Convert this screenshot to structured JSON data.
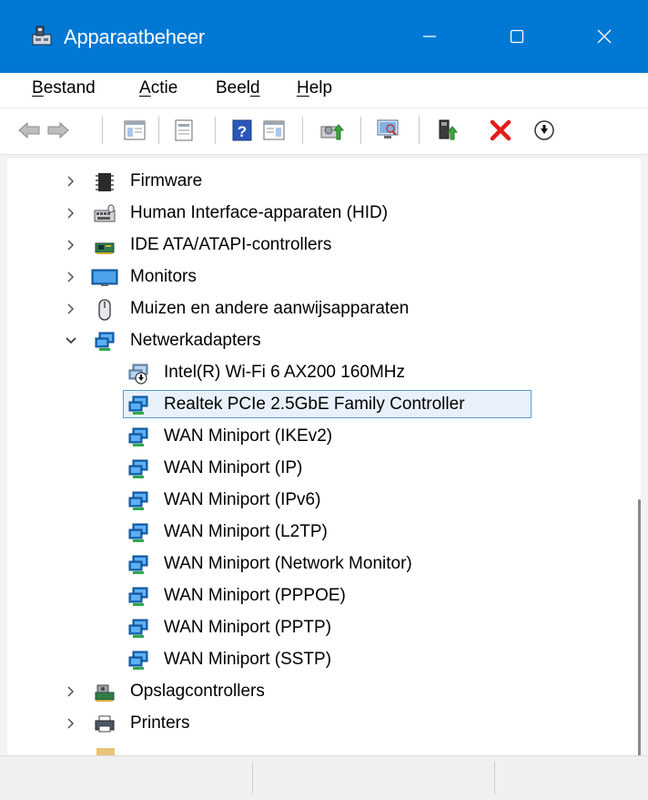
{
  "window": {
    "title": "Apparaatbeheer",
    "accent_color": "#0078d4",
    "icon": "device-manager-icon"
  },
  "menu": {
    "items": [
      {
        "label": "Bestand",
        "underline": "B",
        "rest": "estand"
      },
      {
        "label": "Actie",
        "underline": "A",
        "rest": "ctie"
      },
      {
        "label": "Beeld",
        "pre": "Beel",
        "underline": "d"
      },
      {
        "label": "Help",
        "underline": "H",
        "rest": "elp"
      }
    ]
  },
  "toolbar": {
    "buttons": [
      "back-arrow-icon",
      "forward-arrow-icon",
      "show-hide-console-tree-icon",
      "properties-icon",
      "help-icon",
      "show-action-pane-icon",
      "update-driver-icon",
      "scan-hardware-icon",
      "add-legacy-hardware-icon",
      "uninstall-device-icon",
      "disable-device-icon"
    ]
  },
  "tree": {
    "nodes": [
      {
        "label": "Firmware",
        "icon": "firmware-chip-icon",
        "expander": "collapsed",
        "level": 0
      },
      {
        "label": "Human Interface-apparaten (HID)",
        "icon": "hid-keyboard-icon",
        "expander": "collapsed",
        "level": 0
      },
      {
        "label": "IDE ATA/ATAPI-controllers",
        "icon": "ide-controller-icon",
        "expander": "collapsed",
        "level": 0
      },
      {
        "label": "Monitors",
        "icon": "monitor-icon",
        "expander": "collapsed",
        "level": 0
      },
      {
        "label": "Muizen en andere aanwijsapparaten",
        "icon": "mouse-icon",
        "expander": "collapsed",
        "level": 0
      },
      {
        "label": "Netwerkadapters",
        "icon": "network-adapter-icon",
        "expander": "expanded",
        "level": 0
      },
      {
        "label": "Intel(R) Wi-Fi 6 AX200 160MHz",
        "icon": "network-adapter-disabled-icon",
        "level": 1
      },
      {
        "label": "Realtek PCIe 2.5GbE Family Controller",
        "icon": "network-adapter-icon",
        "level": 1,
        "selected": true
      },
      {
        "label": "WAN Miniport (IKEv2)",
        "icon": "network-adapter-icon",
        "level": 1
      },
      {
        "label": "WAN Miniport (IP)",
        "icon": "network-adapter-icon",
        "level": 1
      },
      {
        "label": "WAN Miniport (IPv6)",
        "icon": "network-adapter-icon",
        "level": 1
      },
      {
        "label": "WAN Miniport (L2TP)",
        "icon": "network-adapter-icon",
        "level": 1
      },
      {
        "label": "WAN Miniport (Network Monitor)",
        "icon": "network-adapter-icon",
        "level": 1
      },
      {
        "label": "WAN Miniport (PPPOE)",
        "icon": "network-adapter-icon",
        "level": 1
      },
      {
        "label": "WAN Miniport (PPTP)",
        "icon": "network-adapter-icon",
        "level": 1
      },
      {
        "label": "WAN Miniport (SSTP)",
        "icon": "network-adapter-icon",
        "level": 1
      },
      {
        "label": "Opslagcontrollers",
        "icon": "storage-controller-icon",
        "expander": "collapsed",
        "level": 0
      },
      {
        "label": "Printers",
        "icon": "printer-icon",
        "expander": "collapsed",
        "level": 0
      }
    ]
  },
  "statusbar": {
    "panes": [
      "",
      "",
      ""
    ]
  }
}
